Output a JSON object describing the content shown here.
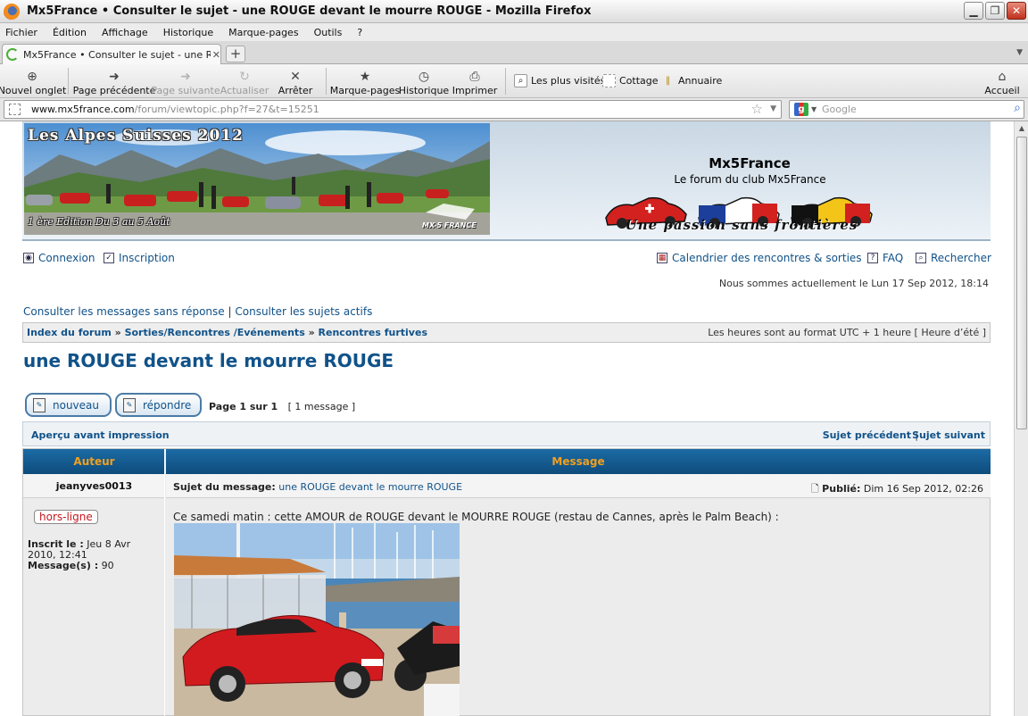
{
  "window": {
    "title": "Mx5France • Consulter le sujet - une ROUGE devant le mourre ROUGE - Mozilla Firefox"
  },
  "menubar": {
    "items": [
      "Fichier",
      "Édition",
      "Affichage",
      "Historique",
      "Marque-pages",
      "Outils",
      "?"
    ]
  },
  "tabs": [
    {
      "label": "Mx5France • Consulter le sujet - une ROUGE..."
    }
  ],
  "toolbar": {
    "new_tab": "Nouvel onglet",
    "back": "Page précédente",
    "forward": "Page suivante",
    "reload": "Actualiser",
    "stop": "Arrêter",
    "bookmarks": "Marque-pages",
    "history": "Historique",
    "print": "Imprimer",
    "home": "Accueil"
  },
  "bookmarks_bar": [
    "Les plus visités",
    "Cottage",
    "Annuaire"
  ],
  "urlbar": {
    "domain": "www.mx5france.com",
    "path": "/forum/viewtopic.php?f=27&t=15251"
  },
  "searchbar": {
    "placeholder": "Google"
  },
  "site": {
    "banner_title": "Les Alpes Suisses 2012",
    "banner_subtitle": "1 ère Edition Du 3 au 5 Août",
    "name": "Mx5France",
    "description": "Le forum du club Mx5France",
    "slogan": "Une passion sans frontières",
    "logo_text": "MX-5 FRANCE"
  },
  "toplinks": {
    "login": "Connexion",
    "register": "Inscription",
    "calendar": "Calendrier des rencontres & sorties",
    "faq": "FAQ",
    "search": "Rechercher"
  },
  "date_line": "Nous sommes actuellement le Lun 17 Sep 2012, 18:14",
  "quicklinks": {
    "unanswered": "Consulter les messages sans réponse",
    "separator": "|",
    "active": "Consulter les sujets actifs"
  },
  "breadcrumb": {
    "items": [
      "Index du forum",
      "Sorties/Rencontres /Evénements",
      "Rencontres furtives"
    ],
    "timezone": "Les heures sont au format UTC + 1 heure [ Heure d’été ]"
  },
  "topic": {
    "title": "une ROUGE devant le mourre ROUGE",
    "new_button": "nouveau",
    "reply_button": "répondre",
    "page_info": "Page 1 sur 1",
    "message_count": "[ 1 message ]",
    "print_preview": "Aperçu avant impression",
    "prev_topic": "Sujet précédent",
    "next_topic": "Sujet suivant",
    "nav_separator": "|"
  },
  "post_table": {
    "author_header": "Auteur",
    "message_header": "Message"
  },
  "post": {
    "author": "jeanyves0013",
    "status": "hors-ligne",
    "joined_label": "Inscrit le :",
    "joined_value": "Jeu 8 Avr 2010, 12:41",
    "messages_label": "Message(s) :",
    "messages_value": "90",
    "subject_label": "Sujet du message:",
    "subject": "une ROUGE devant le mourre ROUGE",
    "published_label": "Publié:",
    "published_value": "Dim 16 Sep 2012, 02:26",
    "body": "Ce samedi matin : cette AMOUR de ROUGE devant le MOURRE ROUGE (restau de Cannes, après le Palm Beach) :"
  }
}
